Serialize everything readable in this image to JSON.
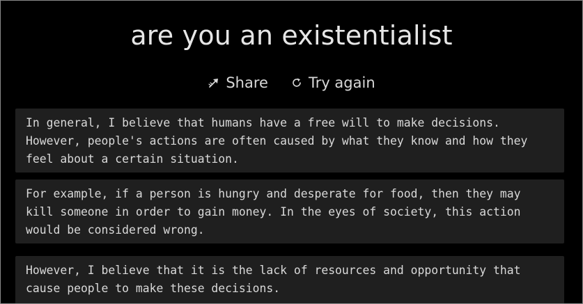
{
  "page": {
    "title": "are you an existentialist"
  },
  "actions": {
    "share_label": "Share",
    "share_icon": "share-arrow-icon",
    "try_again_label": "Try again",
    "try_again_icon": "refresh-icon"
  },
  "responses": [
    {
      "text": "In general, I believe that humans have a free will to make decisions. However, people's actions are often caused by what they know and how they feel about a certain situation."
    },
    {
      "text": "For example, if a person is hungry and desperate for food, then they may kill someone in order to gain money. In the eyes of society, this action would be considered wrong."
    },
    {
      "text": "However, I believe that it is the lack of resources and opportunity that cause people to make these decisions."
    }
  ],
  "colors": {
    "background": "#000000",
    "card_background": "#1f1f1f",
    "text": "#d9d9d9"
  }
}
